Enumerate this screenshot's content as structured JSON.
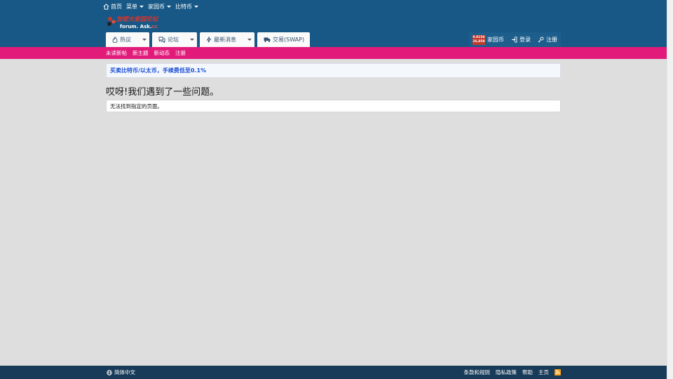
{
  "topnav": {
    "home": "首页",
    "menu": "菜单",
    "homecoin": "家园币",
    "bitcoin": "比特币"
  },
  "logo": {
    "line1": "加密大家园论坛",
    "line2": "forum. Ask.",
    "line2_suffix": "cc"
  },
  "navtabs": [
    {
      "label": "热议",
      "icon": "fire-icon"
    },
    {
      "label": "论坛",
      "icon": "comments-icon"
    },
    {
      "label": "最新消息",
      "icon": "bolt-icon"
    },
    {
      "label": "交易(SWAP)",
      "icon": "truck-icon"
    }
  ],
  "rightnav": {
    "coin_top": "0.0156",
    "coin_bottom": "26,858",
    "coin_label": "家园币",
    "login": "登录",
    "register": "注册"
  },
  "subnav": [
    "未读新帖",
    "新主题",
    "新动态",
    "注册"
  ],
  "notice": "买卖比特币/以太币，手续费低至0.1%",
  "error": {
    "title": "哎呀!我们遇到了一些问题。",
    "message": "无法找到指定的页面。"
  },
  "footer": {
    "language": "简体中文",
    "links": [
      "条款和规则",
      "隐私政策",
      "帮助",
      "主页"
    ]
  },
  "colors": {
    "header": "#185886",
    "subnav": "#e21b7b",
    "footer": "#183b59",
    "notice_text": "#1c4fd6"
  }
}
